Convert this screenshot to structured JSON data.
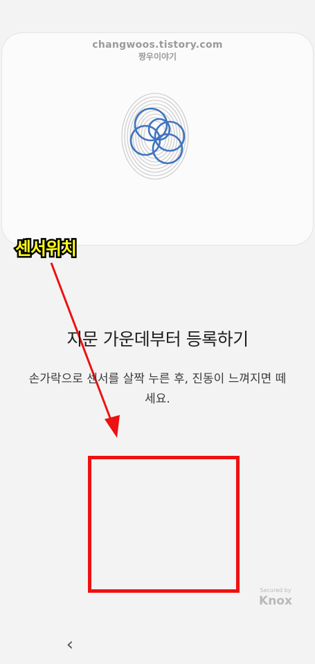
{
  "watermark": {
    "url": "changwoos.tistory.com",
    "name": "짱우이야기"
  },
  "annotation": {
    "sensor_label": "센서위치"
  },
  "main": {
    "title": "지문 가운데부터 등록하기",
    "subtitle": "손가락으로 센서를 살짝 누른 후, 진동이 느껴지면 떼세요."
  },
  "knox": {
    "secured_by": "Secured by",
    "brand": "Knox"
  },
  "nav": {
    "back_icon": "chevron-left-icon",
    "back_glyph": "‹"
  },
  "colors": {
    "accent": "#3f74c0",
    "annotation_red": "#ee1111",
    "label_yellow": "#ffff1a"
  }
}
